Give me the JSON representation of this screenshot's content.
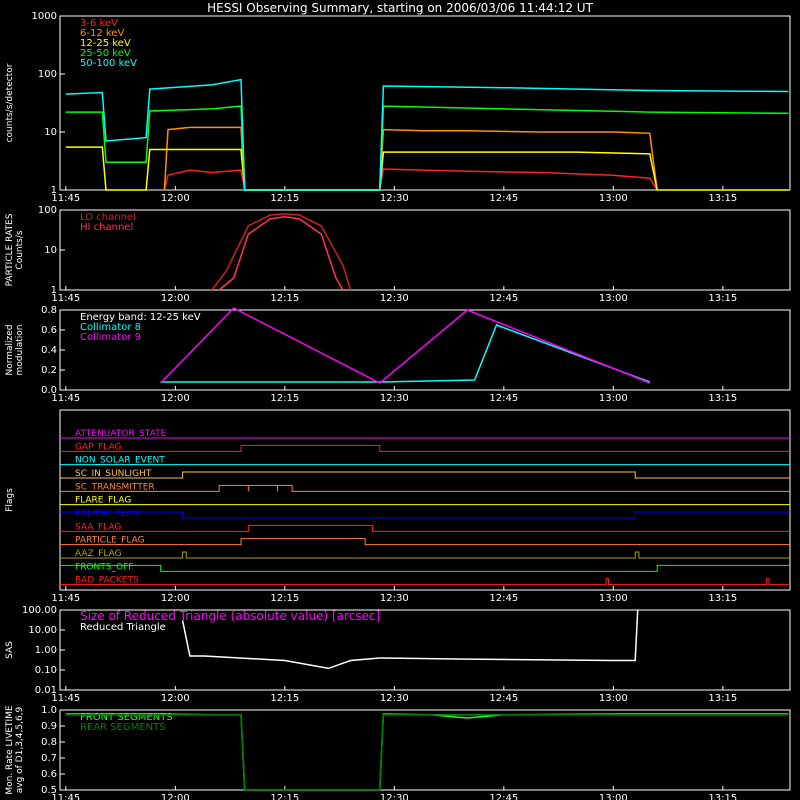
{
  "title": "HESSI Observing Summary, starting on 2006/03/06 11:44:12 UT",
  "time_ticks": [
    "11:45",
    "12:00",
    "12:15",
    "12:30",
    "12:45",
    "13:00",
    "13:15"
  ],
  "chart_data": [
    {
      "type": "line",
      "panel": "count-rates",
      "ylabel": "counts/s/detector",
      "ylog": true,
      "ylim": [
        1,
        1000
      ],
      "yticks": [
        "1",
        "10",
        "100",
        "1000"
      ],
      "x_range": [
        "11:44:12",
        "13:24:12"
      ],
      "series": [
        {
          "name": "3-6 keV",
          "color": "#ff2020",
          "x": [
            "11:58:30",
            "11:59",
            "12:02",
            "12:05",
            "12:09",
            "12:09:30",
            "12:28",
            "12:28:30",
            "12:34",
            "12:40",
            "12:50",
            "13:00",
            "13:05",
            "13:06"
          ],
          "values": [
            1,
            1.8,
            2.2,
            2.0,
            2.2,
            1,
            1,
            2.3,
            2.2,
            2.1,
            2.0,
            1.8,
            1.6,
            1
          ]
        },
        {
          "name": "6-12 keV",
          "color": "#ff9000",
          "x": [
            "11:58:30",
            "11:59",
            "12:02",
            "12:05",
            "12:09",
            "12:09:30",
            "12:28",
            "12:28:30",
            "12:34",
            "12:40",
            "12:50",
            "13:00",
            "13:05",
            "13:06"
          ],
          "values": [
            1,
            11,
            12,
            12,
            12,
            1,
            1,
            11,
            10.5,
            10.5,
            10,
            10,
            9.5,
            1
          ]
        },
        {
          "name": "12-25 keV",
          "color": "#ffff00",
          "x": [
            "11:45",
            "11:50",
            "11:50:30",
            "11:56",
            "11:56:30",
            "12:05",
            "12:09",
            "12:09:30",
            "12:28",
            "12:28:30",
            "12:40",
            "12:55",
            "13:05",
            "13:06",
            "13:24"
          ],
          "values": [
            5.5,
            5.5,
            1,
            1,
            5,
            5,
            5,
            1,
            1,
            4.5,
            4.5,
            4.5,
            4.2,
            1,
            1
          ]
        },
        {
          "name": "25-50 keV",
          "color": "#00ff00",
          "x": [
            "11:45",
            "11:50",
            "11:50:30",
            "11:56",
            "11:56:30",
            "12:05",
            "12:09",
            "12:09:30",
            "12:28",
            "12:28:30",
            "12:45",
            "13:05",
            "13:24"
          ],
          "values": [
            22,
            22,
            3,
            3,
            23,
            25,
            28,
            1,
            1,
            28,
            25,
            22,
            21
          ]
        },
        {
          "name": "50-100 keV",
          "color": "#00ffff",
          "x": [
            "11:45",
            "11:50",
            "11:50:30",
            "11:56",
            "11:56:30",
            "12:05",
            "12:09",
            "12:09:30",
            "12:28",
            "12:28:30",
            "12:45",
            "13:05",
            "13:24"
          ],
          "values": [
            45,
            48,
            7,
            8,
            55,
            65,
            80,
            1,
            1,
            62,
            58,
            52,
            50
          ]
        }
      ]
    },
    {
      "type": "line",
      "panel": "particle-rates",
      "ylabel": [
        "PARTICLE RATES",
        "Counts/s"
      ],
      "ylog": true,
      "ylim": [
        1,
        100
      ],
      "yticks": [
        "1",
        "10",
        "100"
      ],
      "series": [
        {
          "name": "LO channel",
          "color": "#d02020",
          "x": [
            "12:05",
            "12:07",
            "12:10",
            "12:13",
            "12:15",
            "12:17",
            "12:20",
            "12:23",
            "12:24"
          ],
          "values": [
            1,
            3,
            40,
            75,
            80,
            75,
            40,
            4,
            1
          ]
        },
        {
          "name": "HI channel",
          "color": "#ff3060",
          "x": [
            "12:06",
            "12:08",
            "12:10",
            "12:13",
            "12:15",
            "12:17",
            "12:20",
            "12:22",
            "12:23"
          ],
          "values": [
            1,
            2,
            25,
            60,
            68,
            60,
            25,
            2,
            1
          ]
        }
      ]
    },
    {
      "type": "line",
      "panel": "modulation",
      "ylabel": [
        "Normalized",
        "modulation"
      ],
      "ylim": [
        0,
        0.8
      ],
      "yticks": [
        "0.0",
        "0.2",
        "0.4",
        "0.6",
        "0.8"
      ],
      "annotation": "Energy band: 12-25 keV",
      "series": [
        {
          "name": "Collimator 8",
          "color": "#00ffff",
          "x": [
            "11:58",
            "12:09",
            "12:28",
            "12:41",
            "12:44",
            "13:05"
          ],
          "values": [
            0.08,
            0.08,
            0.08,
            0.1,
            0.65,
            0.08
          ]
        },
        {
          "name": "Collimator 9",
          "color": "#ff00ff",
          "x": [
            "11:58",
            "12:08",
            "12:28",
            "12:40",
            "13:05"
          ],
          "values": [
            0.07,
            0.82,
            0.07,
            0.8,
            0.07
          ]
        }
      ]
    },
    {
      "type": "line",
      "panel": "flags",
      "ylabel": "Flags",
      "series": [
        {
          "name": "ATTENUATOR_STATE",
          "color": "#ff00ff",
          "segments": []
        },
        {
          "name": "GAP_FLAG",
          "color": "#ff2020",
          "segments": [
            [
              "12:09",
              "12:28"
            ]
          ]
        },
        {
          "name": "NON_SOLAR_EVENT",
          "color": "#00ffff",
          "segments": []
        },
        {
          "name": "SC_IN_SUNLIGHT",
          "color": "#ffc040",
          "segments": [
            [
              "12:01",
              "13:03"
            ]
          ]
        },
        {
          "name": "SC_TRANSMITTER",
          "color": "#ff8030",
          "segments": [
            [
              "12:06",
              "12:10"
            ],
            [
              "12:10",
              "12:14"
            ],
            [
              "12:14",
              "12:16"
            ]
          ]
        },
        {
          "name": "FLARE_FLAG",
          "color": "#ffff00",
          "segments": []
        },
        {
          "name": "ECLIPSE_FLAG",
          "color": "#0000ff",
          "segments": [
            [
              "12:01",
              "13:03"
            ]
          ],
          "inverted": true
        },
        {
          "name": "SAA_FLAG",
          "color": "#ff2020",
          "segments": [
            [
              "12:10",
              "12:27"
            ]
          ]
        },
        {
          "name": "PARTICLE_FLAG",
          "color": "#ff8040",
          "segments": [
            [
              "12:09",
              "12:26"
            ]
          ]
        },
        {
          "name": "AAZ_FLAG",
          "color": "#b0a000",
          "segments": [
            [
              "12:01",
              "12:01:30"
            ],
            [
              "13:03",
              "13:03:30"
            ]
          ]
        },
        {
          "name": "FRONTS_OFF",
          "color": "#00ff00",
          "segments": [
            [
              "11:58",
              "13:06"
            ]
          ],
          "inverted": true
        },
        {
          "name": "BAD_PACKETS",
          "color": "#ff2020",
          "segments": [
            [
              "12:59",
              "12:59:20"
            ],
            [
              "13:21",
              "13:21:20"
            ]
          ]
        }
      ]
    },
    {
      "type": "line",
      "panel": "sas",
      "ylabel": "SAS",
      "ylog": true,
      "ylim": [
        0.01,
        100
      ],
      "yticks": [
        "0.01",
        "0.10",
        "1.00",
        "10.00",
        "100.00"
      ],
      "annotation": "Size of Reduced Triangle (absolute value) [arcsec]",
      "series": [
        {
          "name": "Reduced Triangle",
          "color": "#ffffff",
          "x": [
            "12:01",
            "12:02",
            "12:04",
            "12:15",
            "12:21",
            "12:24",
            "12:28",
            "12:40",
            "13:00",
            "13:03",
            "13:03:20"
          ],
          "values": [
            30,
            0.5,
            0.5,
            0.3,
            0.12,
            0.3,
            0.4,
            0.35,
            0.3,
            0.3,
            100
          ]
        }
      ]
    },
    {
      "type": "line",
      "panel": "livetime",
      "ylabel": [
        "Mon. Rate LIVETIME",
        "avg of D1,3,4,5,6,9"
      ],
      "ylim": [
        0.5,
        1.0
      ],
      "yticks": [
        "0.5",
        "0.6",
        "0.7",
        "0.8",
        "0.9",
        "1.0"
      ],
      "series": [
        {
          "name": "FRONT SEGMENTS",
          "color": "#20ff20",
          "x": [
            "11:45",
            "11:58",
            "12:05",
            "12:09",
            "12:09:30",
            "12:28",
            "12:28:30",
            "12:35",
            "12:40",
            "12:45",
            "13:00",
            "13:24"
          ],
          "values": [
            0.975,
            0.975,
            0.97,
            0.97,
            0.5,
            0.5,
            0.975,
            0.97,
            0.95,
            0.97,
            0.975,
            0.975
          ]
        },
        {
          "name": "REAR SEGMENTS",
          "color": "#008000",
          "x": [
            "11:45",
            "12:09",
            "12:09:30",
            "12:28",
            "12:28:30",
            "13:24"
          ],
          "values": [
            0.97,
            0.97,
            0.5,
            0.5,
            0.97,
            0.97
          ]
        }
      ]
    }
  ]
}
